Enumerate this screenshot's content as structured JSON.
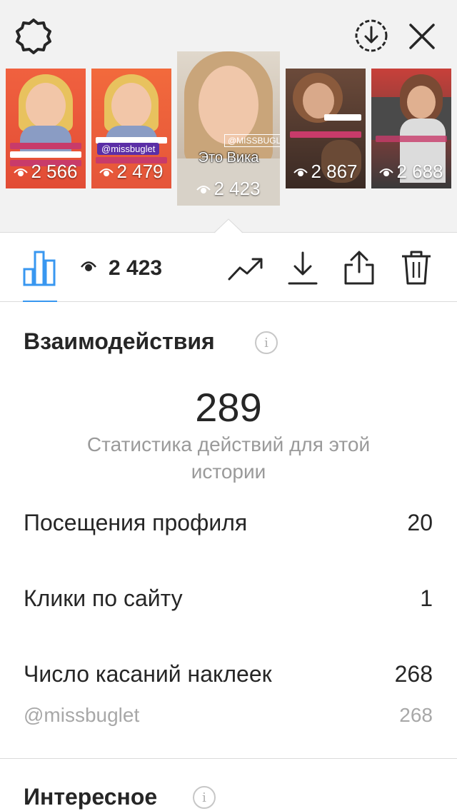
{
  "stories": [
    {
      "views": "2 566",
      "bg": "#e8563e"
    },
    {
      "views": "2 479",
      "bg": "#ec6a3c",
      "tag": "@missbuglet"
    },
    {
      "views": "2 423",
      "bg": "#cdbfae",
      "tag": "@MISSBUGLET",
      "caption": "Это Вика"
    },
    {
      "views": "2 867",
      "bg": "#5a3b2e"
    },
    {
      "views": "2 688",
      "bg": "#8a3a2e"
    }
  ],
  "toolbar": {
    "view_count": "2 423",
    "accent_color": "#3897f0"
  },
  "interactions": {
    "title": "Взаимодействия",
    "total": "289",
    "subtitle": "Статистика действий для этой истории",
    "rows": [
      {
        "label": "Посещения профиля",
        "value": "20"
      },
      {
        "label": "Клики по сайту",
        "value": "1"
      },
      {
        "label": "Число касаний наклеек",
        "value": "268"
      }
    ],
    "sticker_sub": {
      "label": "@missbuglet",
      "value": "268"
    }
  },
  "discovery": {
    "title": "Интересное"
  },
  "icons": {
    "top_left": "gear-icon",
    "top_right": [
      "download-circle-icon",
      "close-icon"
    ],
    "toolbar": [
      "bar-chart-icon",
      "eye-icon",
      "trend-icon",
      "download-icon",
      "share-icon",
      "trash-icon"
    ]
  }
}
